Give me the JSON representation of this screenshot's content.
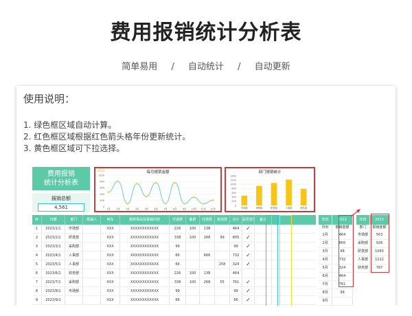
{
  "header": {
    "title": "费用报销统计分析表",
    "features": [
      "简单易用",
      "自动统计",
      "自动更新"
    ],
    "separator": "/"
  },
  "instructions": {
    "title": "使用说明：",
    "items": [
      "1. 绿色框区域自动计算。",
      "2. 红色框区域根据红色箭头格年份更新统计。",
      "3. 黄色框区域可下拉选择。"
    ]
  },
  "sheet": {
    "panel_title_1": "费用报销",
    "panel_title_2": "统计分析表",
    "total_label": "报销总额",
    "total_value": "4,561",
    "line_chart": {
      "title": "每月报销金额",
      "legend": "2023",
      "yticks": [
        "1000",
        "800",
        "600",
        "400",
        "200",
        "0"
      ],
      "months": [
        "1月",
        "2月",
        "3月",
        "4月",
        "5月",
        "6月",
        "7月",
        "8月",
        "9月",
        "10月",
        "11月",
        "12月"
      ],
      "values": [
        464,
        805,
        99,
        732,
        324,
        761,
        99,
        761,
        99,
        300,
        95,
        205
      ]
    },
    "bar_chart": {
      "title": "部门报销统计",
      "yticks": [
        "1400",
        "1200",
        "1000",
        "800",
        "600",
        "400",
        "200",
        "0"
      ],
      "categories": [
        "市场部",
        "采购部",
        "研发部",
        "人事部",
        "财务部"
      ],
      "values": [
        464,
        926,
        1063,
        1222,
        787
      ]
    },
    "columns": [
      "序",
      "日期",
      "部门",
      "报销人",
      "用东",
      "报到事由及报销内容",
      "交通费",
      "餐费",
      "住宿费",
      "其他费",
      "合计",
      "是否签付",
      "备注"
    ],
    "rows": [
      [
        "1",
        "2023/1/1",
        "市场部",
        "",
        "XXX",
        "XXXXXXXXXXXX",
        "226",
        "100",
        "138",
        "",
        "464",
        "✓"
      ],
      [
        "2",
        "2023/2/1",
        "研发部",
        "",
        "XXX",
        "XXXXXXXXXXXX",
        "338",
        "100",
        "268",
        "99",
        "805",
        "✓"
      ],
      [
        "3",
        "2023/3/1",
        "采购部",
        "",
        "XXX",
        "XXXXXXXXXXXX",
        "99",
        "",
        "",
        "",
        "99",
        "✓"
      ],
      [
        "4",
        "2023/4/1",
        "人事部",
        "",
        "XXX",
        "XXXXXXXXXXXX",
        "66",
        "",
        "666",
        "",
        "732",
        "✓"
      ],
      [
        "5",
        "2023/5/1",
        "人事部",
        "",
        "XXX",
        "XXXXXXXXXXXX",
        "66",
        "",
        "",
        "258",
        "324",
        "✓"
      ],
      [
        "6",
        "2023/6/1",
        "财务部",
        "",
        "XXX",
        "XXXXXXXXXXXX",
        "226",
        "100",
        "138",
        "",
        "464",
        ""
      ],
      [
        "7",
        "2023/7/1",
        "采购部",
        "",
        "XXX",
        "XXXXXXXXXXXX",
        "338",
        "100",
        "268",
        "55",
        "761",
        "✓"
      ],
      [
        "8",
        "2023/8/1",
        "市场部",
        "",
        "XXX",
        "XXXXXXXXXXXX",
        "99",
        "",
        "",
        "",
        "99",
        "✓"
      ],
      [
        "9",
        "2023/9/1",
        "",
        "",
        "XXX",
        "XXXXXXXXXXXX",
        "66",
        "",
        "",
        "",
        "66",
        "✓"
      ]
    ],
    "year_header": [
      "年份",
      "2023"
    ],
    "month_header": [
      "月份",
      "报销金额"
    ],
    "monthly": [
      [
        "1月",
        "464"
      ],
      [
        "2月",
        "805"
      ],
      [
        "3月",
        "99"
      ],
      [
        "4月",
        "732"
      ],
      [
        "5月",
        "324"
      ],
      [
        "6月",
        "464"
      ],
      [
        "7月",
        "761"
      ],
      [
        "8月",
        "99"
      ],
      [
        "9月",
        ""
      ]
    ],
    "dept_year_header": [
      "年份",
      "2023"
    ],
    "dept_header": [
      "部门",
      "报销金额"
    ],
    "dept": [
      [
        "市场部",
        "563"
      ],
      [
        "采购部",
        "926"
      ],
      [
        "研发部",
        "1063"
      ],
      [
        "人事部",
        "1222"
      ],
      [
        "财务部",
        "787"
      ]
    ],
    "colors": {
      "green": "#5cc9a7",
      "red": "#d23a3a",
      "cyan": "#2ec4d9",
      "yellow": "#f3de2c",
      "bar": "#f5c518",
      "line": "#7fd4c7"
    }
  }
}
